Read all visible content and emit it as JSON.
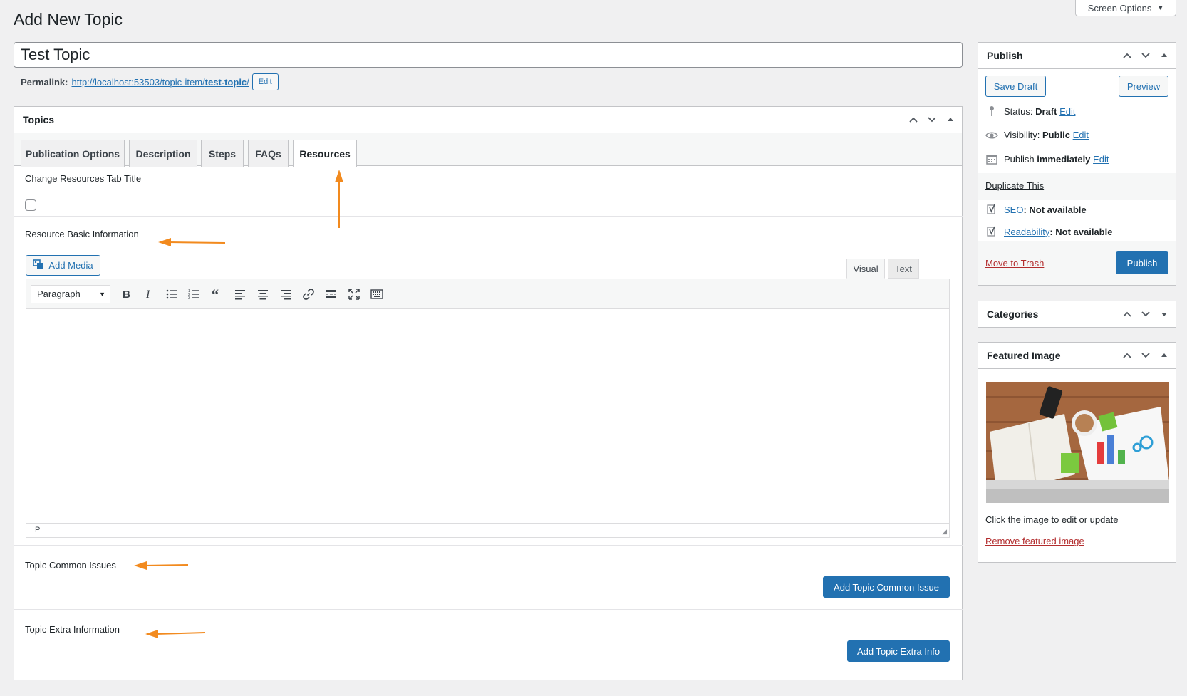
{
  "screen_options": {
    "label": "Screen Options"
  },
  "page": {
    "title": "Add New Topic"
  },
  "title_field": {
    "value": "Test Topic"
  },
  "permalink": {
    "label": "Permalink:",
    "url_base": "http://localhost:53503/topic-item/",
    "slug": "test-topic",
    "trailing": "/",
    "edit_label": "Edit"
  },
  "topics_box": {
    "title": "Topics",
    "tabs": [
      {
        "label": "Publication Options"
      },
      {
        "label": "Description"
      },
      {
        "label": "Steps"
      },
      {
        "label": "FAQs"
      },
      {
        "label": "Resources",
        "active": true
      }
    ],
    "change_title_label": "Change Resources Tab Title",
    "basic_info_label": "Resource Basic Information",
    "add_media_label": "Add Media",
    "editor_tabs": {
      "visual": "Visual",
      "text": "Text"
    },
    "format_select": "Paragraph",
    "status_path": "P",
    "common_issues_label": "Topic Common Issues",
    "add_common_issue_label": "Add Topic Common Issue",
    "extra_info_label": "Topic Extra Information",
    "add_extra_info_label": "Add Topic Extra Info"
  },
  "publish_box": {
    "title": "Publish",
    "save_draft": "Save Draft",
    "preview": "Preview",
    "status_label": "Status:",
    "status_value": "Draft",
    "visibility_label": "Visibility:",
    "visibility_value": "Public",
    "publish_label": "Publish",
    "publish_value": "immediately",
    "edit": "Edit",
    "duplicate": "Duplicate This",
    "seo_label": "SEO",
    "seo_value": ": Not available",
    "readability_label": "Readability",
    "readability_value": ": Not available",
    "move_to_trash": "Move to Trash",
    "publish_button": "Publish"
  },
  "categories_box": {
    "title": "Categories"
  },
  "featured_image_box": {
    "title": "Featured Image",
    "hint": "Click the image to edit or update",
    "remove": "Remove featured image"
  },
  "colors": {
    "primary": "#2271b1",
    "annotation_arrow": "#f28a1e",
    "trash": "#b32d2e"
  }
}
